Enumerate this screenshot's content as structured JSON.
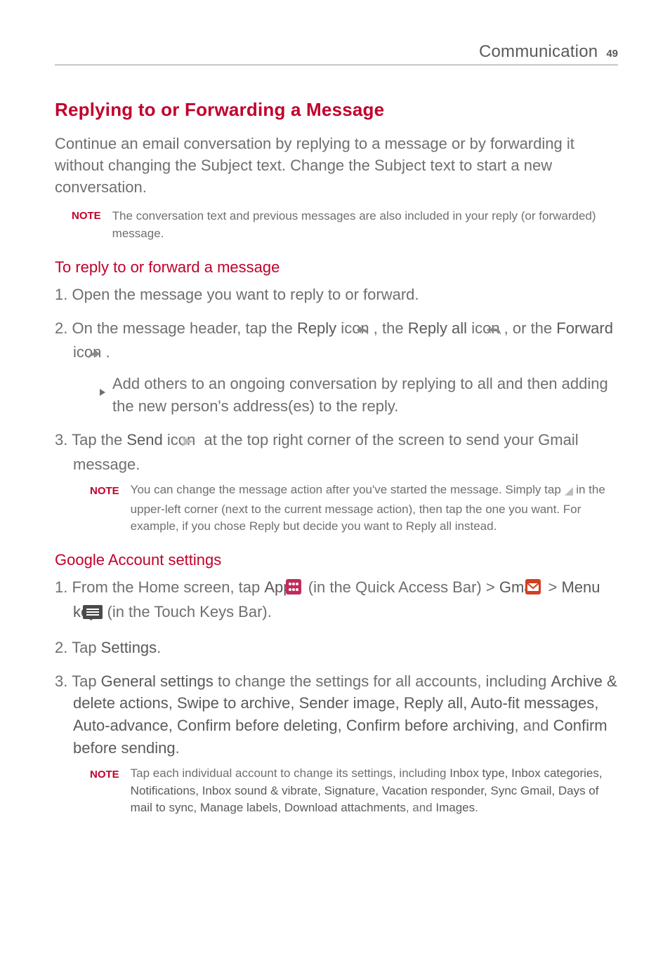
{
  "header": {
    "section": "Communication",
    "page": "49"
  },
  "h1": "Replying to or Forwarding a Message",
  "intro": "Continue an email conversation by replying to a message or by forwarding it without changing the Subject text. Change the Subject text to start a new conversation.",
  "note1": {
    "label": "NOTE",
    "text": "The conversation text and previous messages are also included in your reply (or forwarded) message."
  },
  "sub1": "To reply to or forward a message",
  "s1_1": "Open the message you want to reply to or forward.",
  "s1_2a": "On the message header, tap the ",
  "s1_2_reply": "Reply",
  "s1_2b": " icon ",
  "s1_2c": ", the ",
  "s1_2_replyall": "Reply all",
  "s1_2d": " icon ",
  "s1_2e": ", or the ",
  "s1_2_forward": "Forward",
  "s1_2f": " icon ",
  "s1_2g": ".",
  "s1_2_bullet": "Add others to an ongoing conversation by replying to all and then adding the new person's address(es) to the reply.",
  "s1_3a": "Tap the ",
  "s1_3_send": "Send",
  "s1_3b": " icon ",
  "s1_3c": " at the top right corner of the screen to send your Gmail message.",
  "note2": {
    "label": "NOTE",
    "text_a": "You can change the message action after you've started the message. Simply tap ",
    "text_b": " in the upper-left corner (next to the current message action), then tap the one you want. For example, if you chose Reply but decide you want to Reply all instead."
  },
  "sub2": "Google Account settings",
  "s2_1a": "From the Home screen, tap ",
  "s2_1_apps": "Apps",
  "s2_1b": " ",
  "s2_1c": " (in the Quick Access Bar) > ",
  "s2_1_gmail": "Gmail",
  "s2_1d": " ",
  "s2_1e": " > ",
  "s2_1_menu": "Menu key",
  "s2_1f": " ",
  "s2_1g": " (in the Touch Keys Bar).",
  "s2_2a": "Tap ",
  "s2_2_settings": "Settings",
  "s2_2b": ".",
  "s2_3a": "Tap ",
  "s2_3_gs": "General settings",
  "s2_3b": " to change the settings for all accounts, including ",
  "s2_3_list": "Archive & delete actions, Swipe to archive, Sender image, Reply all, Auto-fit messages, Auto-advance, Confirm before deleting, Confirm before archiving",
  "s2_3c": ", and ",
  "s2_3_last": "Confirm before sending",
  "s2_3d": ".",
  "note3": {
    "label": "NOTE",
    "text_a": "Tap each individual account to change its settings, including ",
    "list": "Inbox type, Inbox categories, Notifications, Inbox sound & vibrate, Signature, Vacation responder, Sync Gmail, Days of mail to sync, Manage labels, Download attachments",
    "text_b": ", and ",
    "last": "Images",
    "text_c": "."
  }
}
